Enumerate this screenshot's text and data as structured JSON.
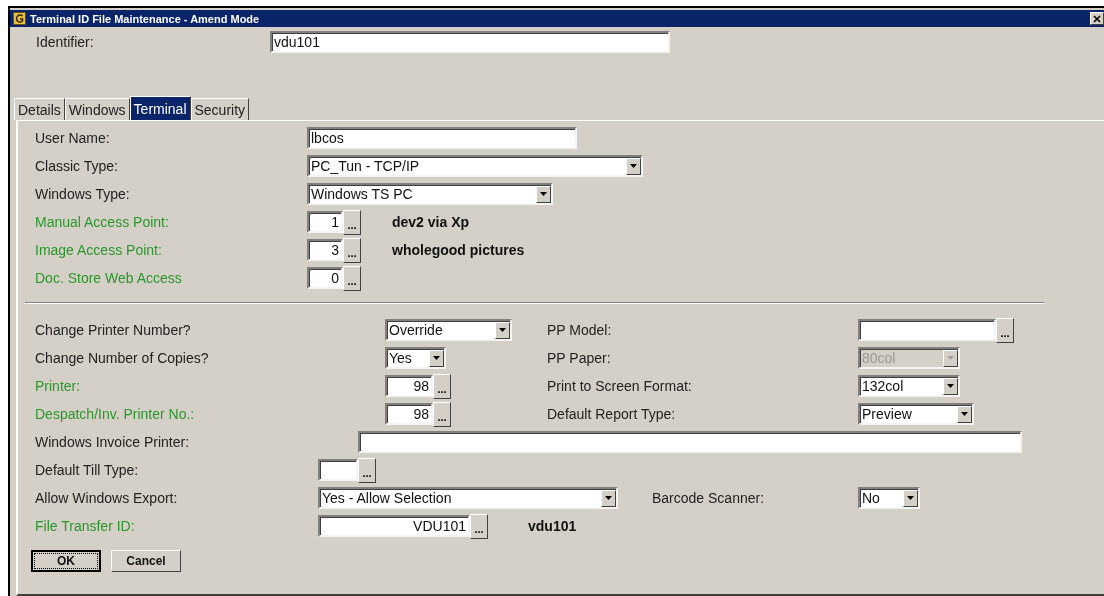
{
  "window": {
    "title": "Terminal ID File Maintenance - Amend Mode"
  },
  "identifier": {
    "label": "Identifier:",
    "value": "vdu101"
  },
  "tabs": [
    {
      "label": "Details",
      "selected": false
    },
    {
      "label": "Windows",
      "selected": false
    },
    {
      "label": "Terminal",
      "selected": true
    },
    {
      "label": "Security",
      "selected": false
    }
  ],
  "terminal_fields": [
    {
      "kind": "text",
      "label": "User Name:",
      "value": "lbcos",
      "highlighted": false
    },
    {
      "kind": "select",
      "label": "Classic Type:",
      "value": "PC_Tun - TCP/IP",
      "highlighted": false
    },
    {
      "kind": "select",
      "label": "Windows Type:",
      "value": "Windows TS PC",
      "highlighted": false
    },
    {
      "kind": "lookup",
      "label": "Manual Access Point:",
      "value": "1",
      "browse": "...",
      "note": "dev2 via Xp",
      "highlighted": true
    },
    {
      "kind": "lookup",
      "label": "Image Access Point:",
      "value": "3",
      "browse": "...",
      "note": "wholegood pictures",
      "highlighted": true
    },
    {
      "kind": "lookup",
      "label": "Doc. Store Web Access",
      "value": "0",
      "browse": "...",
      "highlighted": true
    }
  ],
  "printer_rows": [
    {
      "left": {
        "kind": "select",
        "label": "Change Printer Number?",
        "value": "Override",
        "highlighted": false,
        "disabled": false
      },
      "right": {
        "kind": "lookup",
        "label": "PP Model:",
        "browse": "...",
        "highlighted": false,
        "disabled": false
      }
    },
    {
      "left": {
        "kind": "select",
        "label": "Change Number of Copies?",
        "value": "Yes",
        "highlighted": false,
        "disabled": false
      },
      "right": {
        "kind": "select",
        "label": "PP Paper:",
        "value": "80col",
        "highlighted": false,
        "disabled": true
      }
    },
    {
      "left": {
        "kind": "lookup",
        "label": "Printer:",
        "value": "98",
        "browse": "...",
        "highlighted": true,
        "disabled": false
      },
      "right": {
        "kind": "select",
        "label": "Print to Screen Format:",
        "value": "132col",
        "highlighted": false,
        "disabled": false
      }
    },
    {
      "left": {
        "kind": "lookup",
        "label": "Despatch/Inv. Printer No.:",
        "value": "98",
        "browse": "...",
        "highlighted": true,
        "disabled": false
      },
      "right": {
        "kind": "select",
        "label": "Default Report Type:",
        "value": "Preview",
        "highlighted": false,
        "disabled": false
      }
    },
    {
      "left": {
        "kind": "text",
        "label": "Windows Invoice Printer:",
        "highlighted": false,
        "disabled": false
      }
    },
    {
      "left": {
        "kind": "lookup",
        "label": "Default Till Type:",
        "browse": "...",
        "highlighted": false,
        "disabled": false
      }
    },
    {
      "left": {
        "kind": "select",
        "label": "Allow Windows Export:",
        "value": "Yes - Allow Selection",
        "highlighted": false,
        "disabled": false
      },
      "right": {
        "kind": "select",
        "label": "Barcode Scanner:",
        "value": "No",
        "highlighted": false,
        "disabled": false
      }
    },
    {
      "left": {
        "kind": "lookup",
        "label": "File Transfer ID:",
        "value": "VDU101",
        "browse": "...",
        "note": "vdu101",
        "highlighted": true,
        "disabled": false
      }
    }
  ],
  "buttons": [
    {
      "label": "OK",
      "default": true
    },
    {
      "label": "Cancel",
      "default": false
    }
  ]
}
